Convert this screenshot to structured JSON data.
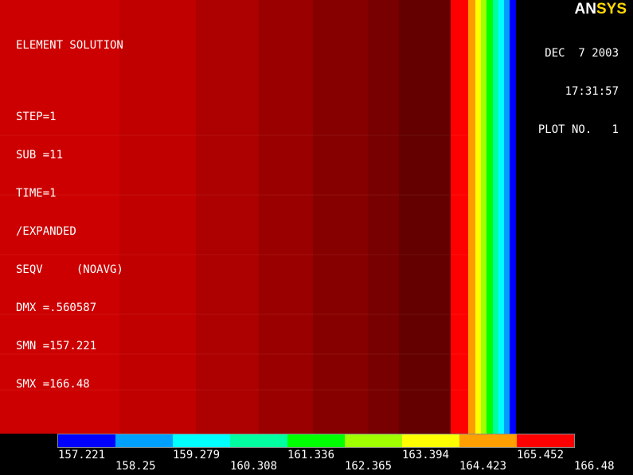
{
  "logo": {
    "part1": "AN",
    "part2": "SYS"
  },
  "info": {
    "title": "ELEMENT SOLUTION",
    "step": "STEP=1",
    "sub": "SUB =11",
    "time": "TIME=1",
    "expanded": "/EXPANDED",
    "seqv": "SEQV     (NOAVG)",
    "dmx": "DMX =.560587",
    "smn": "SMN =157.221",
    "smx": "SMX =166.48"
  },
  "header": {
    "date": "DEC  7 2003",
    "time": "17:31:57",
    "plot_no": "PLOT NO.   1"
  },
  "legend": {
    "colors": [
      "#0000ff",
      "#00a0ff",
      "#00ffff",
      "#00ffa0",
      "#00ff00",
      "#a0ff00",
      "#ffff00",
      "#ffa000",
      "#ff0000"
    ],
    "labels": [
      "157.221",
      "158.25",
      "159.279",
      "160.308",
      "161.336",
      "162.365",
      "163.394",
      "164.423",
      "165.452",
      "166.48"
    ]
  },
  "model": {
    "bands": [
      "#cc0000",
      "#cc0000",
      "#c00000",
      "#ad0000",
      "#9b0000",
      "#870000",
      "#780000",
      "#640000",
      "#ff0000",
      "#ff9a00",
      "#ffff00",
      "#a0ff00",
      "#00ff00",
      "#00ffa0",
      "#00ffff",
      "#00a0ff",
      "#0000ff"
    ]
  }
}
